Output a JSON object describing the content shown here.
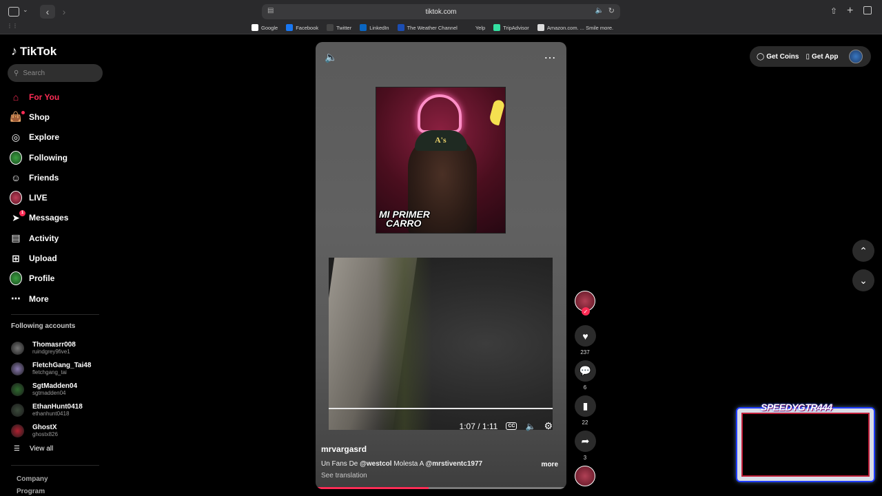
{
  "browser": {
    "url": "tiktok.com",
    "bookmarks": [
      {
        "label": "Google",
        "color": "#ffffff"
      },
      {
        "label": "Facebook",
        "color": "#1877f2"
      },
      {
        "label": "Twitter",
        "color": "#444444"
      },
      {
        "label": "LinkedIn",
        "color": "#0a66c2"
      },
      {
        "label": "The Weather Channel",
        "color": "#1b4db3"
      },
      {
        "label": "Yelp",
        "color": "#2a2a2c"
      },
      {
        "label": "TripAdvisor",
        "color": "#34e0a1"
      },
      {
        "label": "Amazon.com. ... Smile more.",
        "color": "#dddddd"
      }
    ]
  },
  "sidebar": {
    "logo": "TikTok",
    "search_placeholder": "Search",
    "nav": [
      {
        "label": "For You",
        "icon": "home-icon",
        "active": true
      },
      {
        "label": "Shop",
        "icon": "shopping-bag-icon"
      },
      {
        "label": "Explore",
        "icon": "compass-icon"
      },
      {
        "label": "Following",
        "icon": "avatar-icon"
      },
      {
        "label": "Friends",
        "icon": "friends-icon"
      },
      {
        "label": "LIVE",
        "icon": "live-icon"
      },
      {
        "label": "Messages",
        "icon": "send-icon",
        "badge": "1"
      },
      {
        "label": "Activity",
        "icon": "activity-icon"
      },
      {
        "label": "Upload",
        "icon": "plus-square-icon"
      },
      {
        "label": "Profile",
        "icon": "avatar-icon"
      },
      {
        "label": "More",
        "icon": "ellipsis-icon"
      }
    ],
    "following_title": "Following accounts",
    "accounts": [
      {
        "name": "Thomasrr008",
        "handle": "ruindgrey9five1",
        "color": "#777777"
      },
      {
        "name": "FletchGang_Tai48",
        "handle": "fletchgang_tai",
        "color": "#8a7ab0"
      },
      {
        "name": "SgtMadden04",
        "handle": "sgtmadden04",
        "color": "#2e6b2e"
      },
      {
        "name": "EthanHunt0418",
        "handle": "ethanhunt0418",
        "color": "#3b4a3b"
      },
      {
        "name": "GhostX",
        "handle": "ghostx826",
        "color": "#b02030"
      }
    ],
    "view_all": "View all",
    "footer": [
      "Company",
      "Program"
    ]
  },
  "video": {
    "caption_line1": "MI PRIMER",
    "caption_line2": "CARRO",
    "cap_logo": "A's",
    "time": "1:07 / 1:11",
    "cc_label": "CC",
    "author": "mrvargasrd",
    "desc_prefix": "Un Fans De ",
    "mention1": "@westcol",
    "desc_middle": " Molesta A ",
    "mention2": "@mrstiventc1977",
    "more": "more",
    "see_translation": "See translation",
    "progress": 0.45
  },
  "actions": {
    "likes": "237",
    "comments": "6",
    "saves": "22",
    "shares": "3"
  },
  "topright": {
    "coins": "Get Coins",
    "app": "Get App"
  },
  "overlay": {
    "title": "SPEEDYGTR444"
  }
}
